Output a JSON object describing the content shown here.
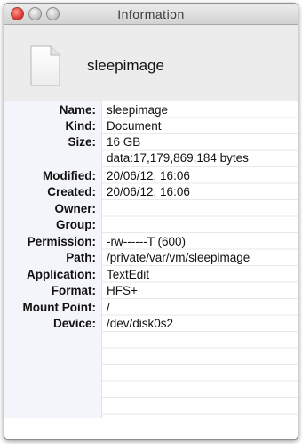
{
  "window": {
    "title": "Information"
  },
  "file": {
    "name": "sleepimage",
    "icon": "document-icon"
  },
  "properties": [
    {
      "label": "Name:",
      "value": "sleepimage"
    },
    {
      "label": "Kind:",
      "value": "Document"
    },
    {
      "label": "Size:",
      "value": "16 GB",
      "value2": "data:17,179,869,184 bytes"
    },
    {
      "label": "Modified:",
      "value": "20/06/12, 16:06"
    },
    {
      "label": "Created:",
      "value": "20/06/12, 16:06"
    },
    {
      "label": "Owner:",
      "value": ""
    },
    {
      "label": "Group:",
      "value": ""
    },
    {
      "label": "Permission:",
      "value": "-rw------T (600)"
    },
    {
      "label": "Path:",
      "value": "/private/var/vm/sleepimage"
    },
    {
      "label": "Application:",
      "value": "TextEdit"
    },
    {
      "label": "Format:",
      "value": "HFS+"
    },
    {
      "label": "Mount Point:",
      "value": "/"
    },
    {
      "label": "Device:",
      "value": "/dev/disk0s2"
    }
  ],
  "colors": {
    "close": "#e0443e",
    "label_column": "#f4f5fa",
    "header": "#ececec"
  }
}
